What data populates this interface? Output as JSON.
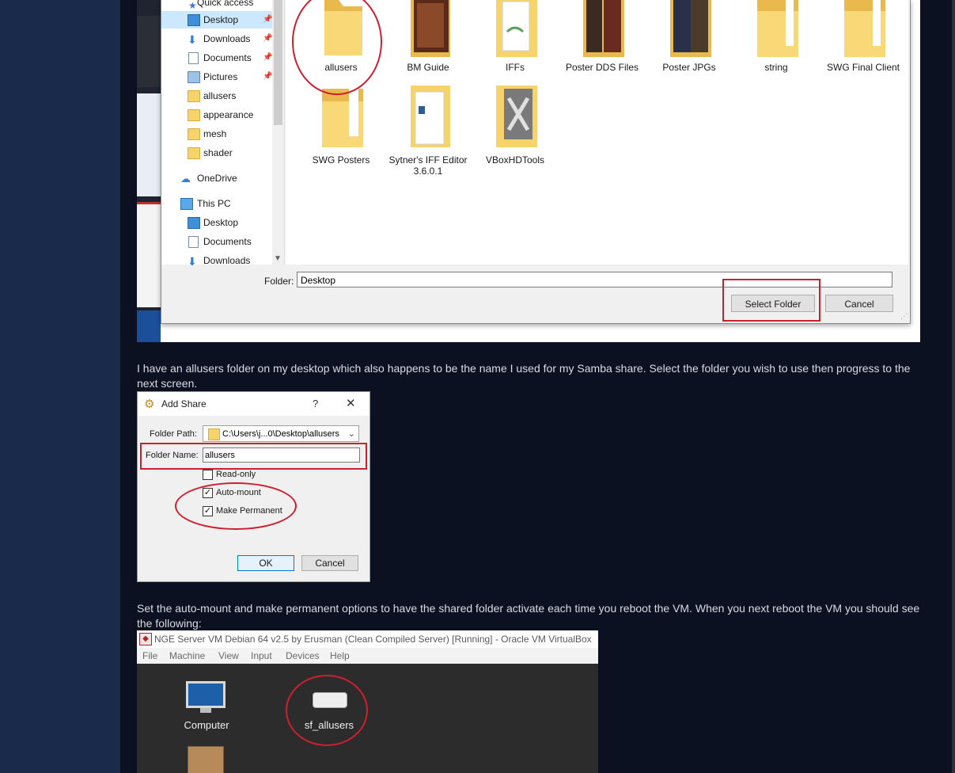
{
  "nav_pane": {
    "items": [
      {
        "label": "Quick access",
        "icon": "star-icon"
      },
      {
        "label": "Desktop",
        "icon": "desktop-icon",
        "pinned": true,
        "selected": true
      },
      {
        "label": "Downloads",
        "icon": "download-icon",
        "pinned": true
      },
      {
        "label": "Documents",
        "icon": "document-icon",
        "pinned": true
      },
      {
        "label": "Pictures",
        "icon": "picture-icon",
        "pinned": true
      },
      {
        "label": "allusers",
        "icon": "folder-icon"
      },
      {
        "label": "appearance",
        "icon": "folder-icon"
      },
      {
        "label": "mesh",
        "icon": "folder-icon"
      },
      {
        "label": "shader",
        "icon": "folder-icon"
      },
      {
        "label": "OneDrive",
        "icon": "cloud-icon"
      },
      {
        "label": "This PC",
        "icon": "computer-icon"
      },
      {
        "label": "Desktop",
        "icon": "desktop-icon"
      },
      {
        "label": "Documents",
        "icon": "document-icon"
      },
      {
        "label": "Downloads",
        "icon": "download-icon"
      }
    ]
  },
  "files": [
    {
      "label": "allusers"
    },
    {
      "label": "BM Guide"
    },
    {
      "label": "IFFs"
    },
    {
      "label": "Poster DDS Files"
    },
    {
      "label": "Poster JPGs"
    },
    {
      "label": "string"
    },
    {
      "label": "SWG Final Client"
    },
    {
      "label": "SWG Posters"
    },
    {
      "label": "Sytner's IFF Editor 3.6.0.1"
    },
    {
      "label": "VBoxHDTools"
    }
  ],
  "folder_field": {
    "label": "Folder:",
    "value": "Desktop"
  },
  "buttons": {
    "select_folder": "Select Folder",
    "cancel": "Cancel"
  },
  "text": {
    "para1": "I have an allusers folder on my desktop which also happens to be the name I used for my Samba share. Select the folder you wish to use then progress to the next screen.",
    "para2": "Set the auto-mount and make permanent options to have the shared folder activate each time you reboot the VM. When you next reboot the VM you should see the following:"
  },
  "add_share": {
    "title": "Add Share",
    "help": "?",
    "close": "✕",
    "folder_path_label": "Folder Path:",
    "folder_path_value": "C:\\Users\\j...0\\Desktop\\allusers",
    "folder_name_label": "Folder Name:",
    "folder_name_value": "allusers",
    "readonly_label": "Read-only",
    "automount_label": "Auto-mount",
    "permanent_label": "Make Permanent",
    "readonly_checked": false,
    "automount_checked": true,
    "permanent_checked": true,
    "ok": "OK",
    "cancel": "Cancel"
  },
  "vm": {
    "title": "NGE Server VM Debian 64 v2.5 by Erusman (Clean Compiled Server) [Running] - Oracle VM VirtualBox",
    "menu": [
      "File",
      "Machine",
      "View",
      "Input",
      "Devices",
      "Help"
    ],
    "desktop_icons": [
      {
        "label": "Computer",
        "icon": "monitor-icon"
      },
      {
        "label": "sf_allusers",
        "icon": "drive-icon"
      }
    ]
  },
  "colors": {
    "annotation_ring": "#cc1f2f",
    "selection": "#cce8ff",
    "folder_yellow": "#f6d36b"
  }
}
